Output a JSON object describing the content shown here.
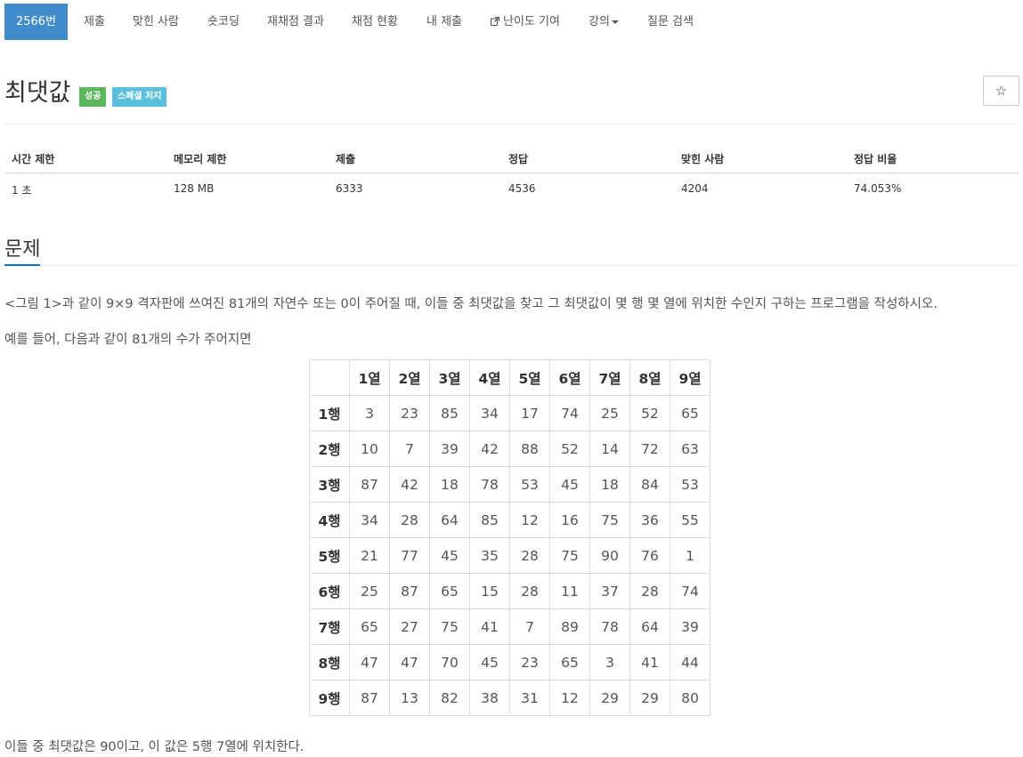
{
  "nav": {
    "items": [
      "2566번",
      "제출",
      "맞힌 사람",
      "숏코딩",
      "재채점 결과",
      "채점 현황",
      "내 제출",
      "난이도 기여",
      "강의",
      "질문 검색"
    ],
    "accent": "#428bca"
  },
  "problem": {
    "title": "최댓값",
    "badges": [
      {
        "label": "성공",
        "color": "#5cb85c"
      },
      {
        "label": "스페셜 저지",
        "color": "#5bc0de"
      }
    ],
    "star": "☆"
  },
  "stats": {
    "headers": [
      "시간 제한",
      "메모리 제한",
      "제출",
      "정답",
      "맞힌 사람",
      "정답 비율"
    ],
    "values": [
      "1 초",
      "128 MB",
      "6333",
      "4536",
      "4204",
      "74.053%"
    ]
  },
  "section": {
    "title": "문제",
    "p1": "<그림 1>과 같이 9×9 격자판에 쓰여진 81개의 자연수 또는 0이 주어질 때, 이들 중 최댓값을 찾고 그 최댓값이 몇 행 몇 열에 위치한 수인지 구하는 프로그램을 작성하시오.",
    "p2": "예를 들어, 다음과 같이 81개의 수가 주어지면",
    "p3": "이들 중 최댓값은 90이고, 이 값은 5행 7열에 위치한다."
  },
  "grid": {
    "col_headers": [
      "1열",
      "2열",
      "3열",
      "4열",
      "5열",
      "6열",
      "7열",
      "8열",
      "9열"
    ],
    "rows": [
      {
        "label": "1행",
        "cells": [
          "3",
          "23",
          "85",
          "34",
          "17",
          "74",
          "25",
          "52",
          "65"
        ]
      },
      {
        "label": "2행",
        "cells": [
          "10",
          "7",
          "39",
          "42",
          "88",
          "52",
          "14",
          "72",
          "63"
        ]
      },
      {
        "label": "3행",
        "cells": [
          "87",
          "42",
          "18",
          "78",
          "53",
          "45",
          "18",
          "84",
          "53"
        ]
      },
      {
        "label": "4행",
        "cells": [
          "34",
          "28",
          "64",
          "85",
          "12",
          "16",
          "75",
          "36",
          "55"
        ]
      },
      {
        "label": "5행",
        "cells": [
          "21",
          "77",
          "45",
          "35",
          "28",
          "75",
          "90",
          "76",
          "1"
        ]
      },
      {
        "label": "6행",
        "cells": [
          "25",
          "87",
          "65",
          "15",
          "28",
          "11",
          "37",
          "28",
          "74"
        ]
      },
      {
        "label": "7행",
        "cells": [
          "65",
          "27",
          "75",
          "41",
          "7",
          "89",
          "78",
          "64",
          "39"
        ]
      },
      {
        "label": "8행",
        "cells": [
          "47",
          "47",
          "70",
          "45",
          "23",
          "65",
          "3",
          "41",
          "44"
        ]
      },
      {
        "label": "9행",
        "cells": [
          "87",
          "13",
          "82",
          "38",
          "31",
          "12",
          "29",
          "29",
          "80"
        ]
      }
    ]
  }
}
